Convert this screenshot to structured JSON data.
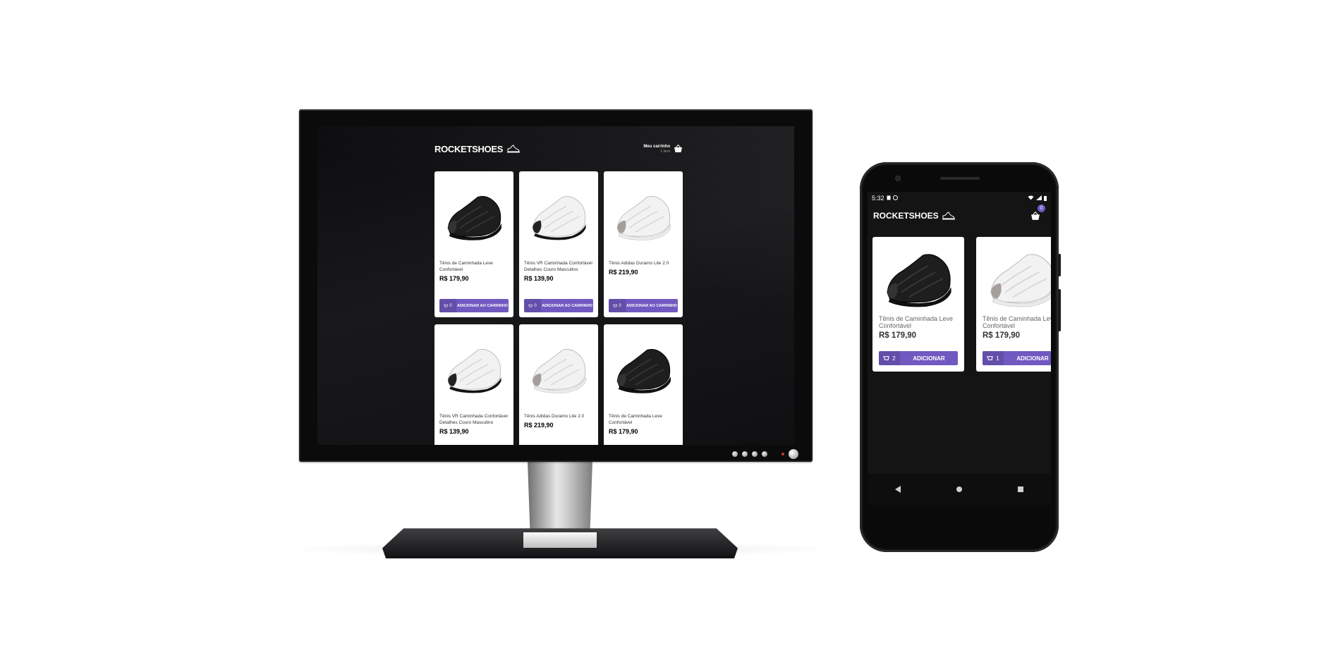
{
  "brand": {
    "name": "ROCKETSHOES",
    "accent": "#7159c1"
  },
  "desktop": {
    "cart": {
      "title": "Meu carrinho",
      "count": "1 item"
    },
    "products": [
      {
        "title": "Tênis de Caminhada Leve Confortável",
        "price": "R$ 179,90",
        "qty": "0",
        "button": "ADICIONAR AO CARRINHO",
        "shoe_color": "black"
      },
      {
        "title": "Tênis VR Caminhada Confortável Detalhes Couro Masculino",
        "price": "R$ 139,90",
        "qty": "0",
        "button": "ADICIONAR AO CARRINHO",
        "shoe_color": "white-black"
      },
      {
        "title": "Tênis Adidas Duramo Lite 2.0",
        "price": "R$ 219,90",
        "qty": "0",
        "button": "ADICIONAR AO CARRINHO",
        "shoe_color": "white-grey"
      },
      {
        "title": "Tênis VR Caminhada Confortável Detalhes Couro Masculino",
        "price": "R$ 139,90",
        "qty": "",
        "button": "",
        "shoe_color": "white-black"
      },
      {
        "title": "Tênis Adidas Duramo Lite 2.0",
        "price": "R$ 219,90",
        "qty": "",
        "button": "",
        "shoe_color": "white-grey"
      },
      {
        "title": "Tênis de Caminhada Leve Confortável",
        "price": "R$ 179,90",
        "qty": "",
        "button": "",
        "shoe_color": "black"
      }
    ]
  },
  "mobile": {
    "status": {
      "time": "5:32"
    },
    "cart_badge": "0",
    "products": [
      {
        "title": "Tênis de Caminhada Leve Confortável",
        "price": "R$ 179,90",
        "qty": "2",
        "button": "ADICIONAR",
        "shoe_color": "black"
      },
      {
        "title": "Tênis de Caminhada Leve Confortável",
        "price": "R$ 179,90",
        "qty": "1",
        "button": "ADICIONAR",
        "shoe_color": "white-grey"
      }
    ]
  }
}
